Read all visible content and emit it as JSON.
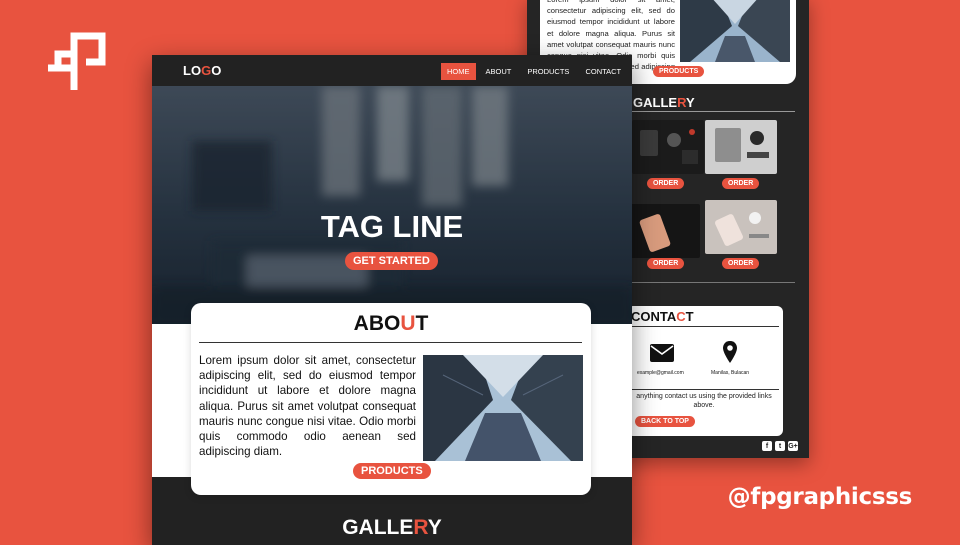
{
  "theme": {
    "accent": "#e8533f",
    "dark": "#222222",
    "light": "#ffffff"
  },
  "brand": {
    "handle": "@fpgraphicsss",
    "logo_icon": "fp-monogram-icon"
  },
  "nav": {
    "logo_a": "LO",
    "logo_b": "G",
    "logo_c": "O",
    "items": [
      "HOME",
      "ABOUT",
      "PRODUCTS",
      "CONTACT"
    ],
    "active": "HOME"
  },
  "hero": {
    "tagline": "TAG LINE",
    "cta": "GET STARTED"
  },
  "about": {
    "title_a": "ABO",
    "title_b": "U",
    "title_c": "T",
    "text": "Lorem ipsum dolor sit amet, consectetur adipiscing elit, sed do eiusmod tempor incididunt ut labore et dolore magna aliqua. Purus sit amet volutpat consequat mauris nunc congue nisi vitae. Odio morbi quis commodo odio aenean sed adipiscing diam.",
    "button": "PRODUCTS"
  },
  "gallery": {
    "title_a": "GALLE",
    "title_b": "R",
    "title_c": "Y"
  },
  "back_page": {
    "about_text": "Lorem ipsum dolor sit amet, consectetur adipiscing elit, sed do eiusmod tempor incididunt ut labore et dolore magna aliqua. Purus sit amet volutpat consequat mauris nunc congue nisi vitae. Odio morbi quis commodo odio aenean sed adipiscing diam.",
    "about_button": "PRODUCTS",
    "gallery_title_a": "GALLE",
    "gallery_title_b": "R",
    "gallery_title_c": "Y",
    "order_label": "ORDER",
    "contact_title_a": "CONTA",
    "contact_title_b": "C",
    "contact_title_c": "T",
    "email": "example@gmail.com",
    "location": "Manilas, Bulacan",
    "note": "anything contact us using the provided links above.",
    "back_to_top": "BACK TO TOP",
    "social": [
      {
        "icon": "facebook-icon",
        "glyph": "f"
      },
      {
        "icon": "twitter-icon",
        "glyph": "t"
      },
      {
        "icon": "google-plus-icon",
        "glyph": "G+"
      }
    ]
  }
}
